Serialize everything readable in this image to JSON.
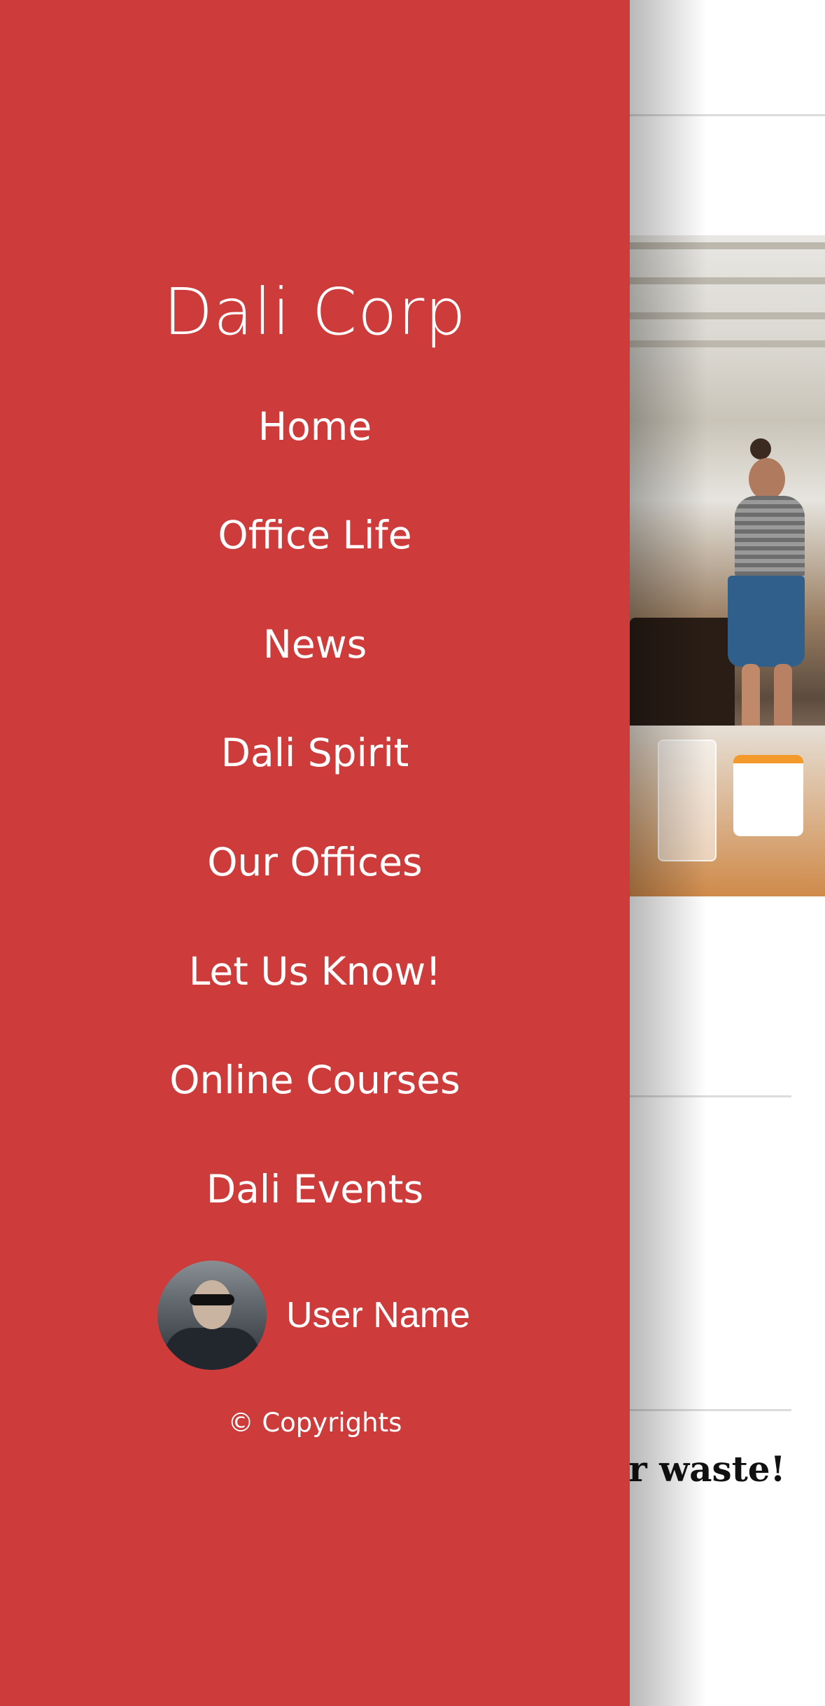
{
  "drawer": {
    "brand": "Dali Corp",
    "background_color": "#cd3b3b",
    "nav_items": [
      {
        "label": "Home"
      },
      {
        "label": "Office Life"
      },
      {
        "label": "News"
      },
      {
        "label": "Dali Spirit"
      },
      {
        "label": "Our Offices"
      },
      {
        "label": "Let Us Know!"
      },
      {
        "label": "Online Courses"
      },
      {
        "label": "Dali Events"
      }
    ],
    "user": {
      "name": "User Name",
      "avatar_icon": "user-avatar"
    },
    "copyright": "© Copyrights"
  },
  "background_page": {
    "heading_fragment": "ur waste!"
  }
}
